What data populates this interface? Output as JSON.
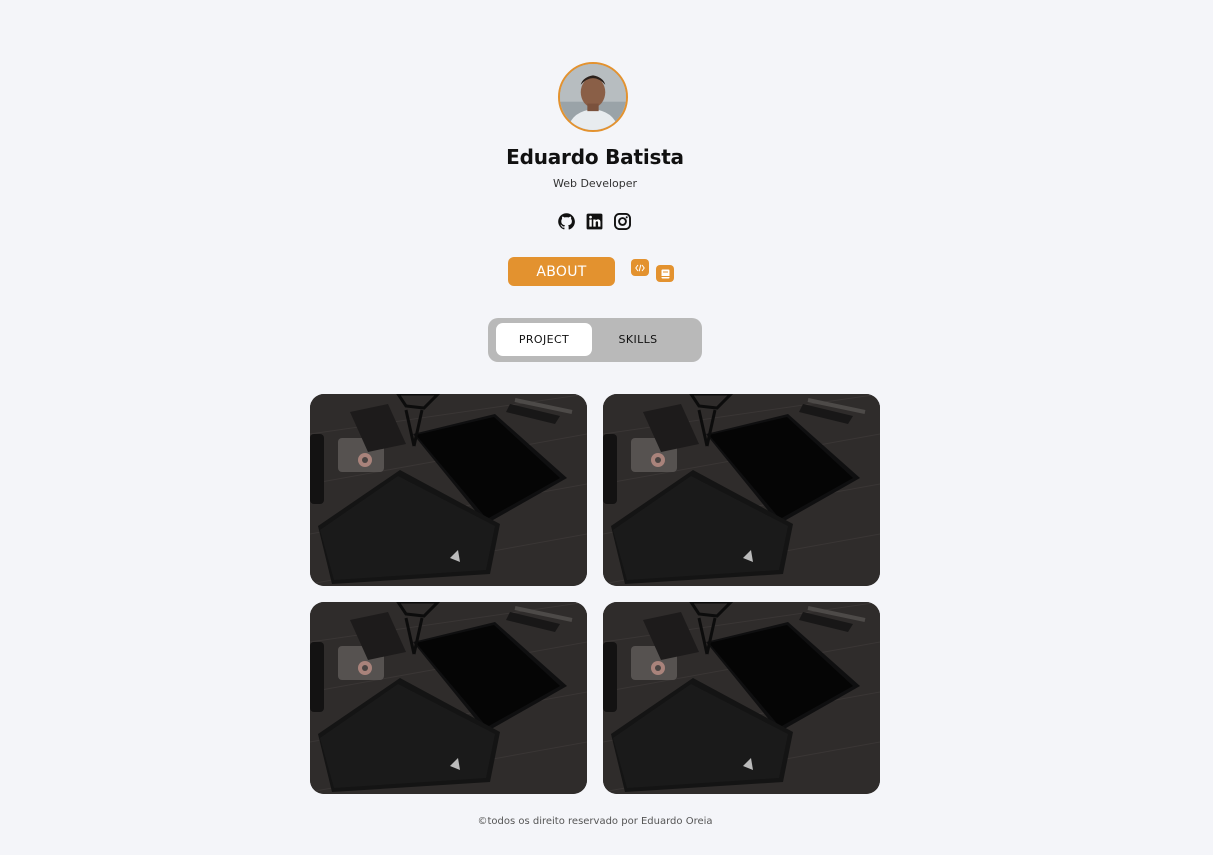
{
  "profile": {
    "name": "Eduardo Batista",
    "role": "Web Developer",
    "avatar_icon": "avatar-photo"
  },
  "social": [
    {
      "icon": "github-icon"
    },
    {
      "icon": "linkedin-icon"
    },
    {
      "icon": "instagram-icon"
    }
  ],
  "actions": {
    "about_label": "ABOUT",
    "code_icon": "code-icon",
    "book_icon": "book-icon"
  },
  "tabs": [
    {
      "label": "PROJECT",
      "active": true
    },
    {
      "label": "SKILLS",
      "active": false
    }
  ],
  "projects": [
    {
      "image": "desk-workspace-photo"
    },
    {
      "image": "desk-workspace-photo"
    },
    {
      "image": "desk-workspace-photo"
    },
    {
      "image": "desk-workspace-photo"
    }
  ],
  "footer": {
    "text": "©todos os direito reservado por Eduardo Oreia"
  },
  "colors": {
    "accent": "#e3922f",
    "background": "#f4f5f9",
    "tab_track": "#b9b9b9"
  }
}
